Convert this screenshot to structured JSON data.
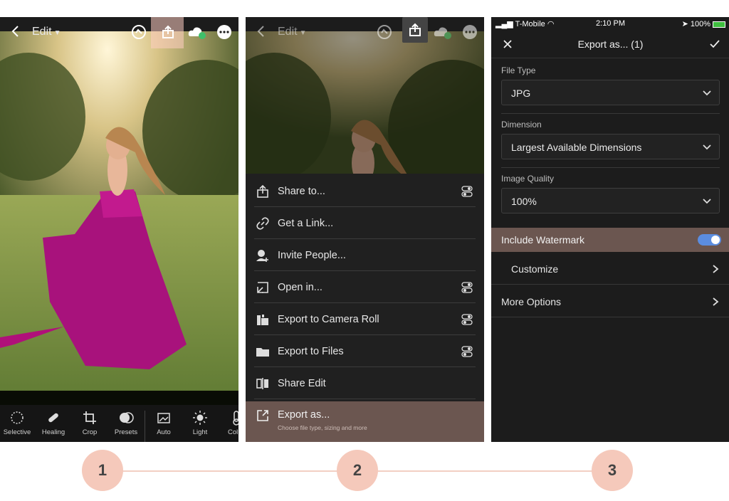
{
  "colors": {
    "accent_highlight": "#6b5650",
    "toggle_on": "#5b8de0",
    "panel_bg": "#1c1c1c",
    "step_circle": "#f5c9bb",
    "step_line": "#f2cfc3"
  },
  "panel1": {
    "header": {
      "edit_label": "Edit"
    },
    "toolbar": [
      {
        "label": "Selective",
        "icon": "selective-icon"
      },
      {
        "label": "Healing",
        "icon": "healing-icon"
      },
      {
        "label": "Crop",
        "icon": "crop-icon"
      },
      {
        "label": "Presets",
        "icon": "presets-icon"
      },
      {
        "label": "Auto",
        "icon": "auto-icon"
      },
      {
        "label": "Light",
        "icon": "light-icon"
      },
      {
        "label": "Col",
        "icon": "color-icon"
      }
    ]
  },
  "panel2": {
    "header": {
      "edit_label": "Edit"
    },
    "menu": [
      {
        "label": "Share to...",
        "icon": "share-icon",
        "has_toggle": true
      },
      {
        "label": "Get a Link...",
        "icon": "link-icon",
        "has_toggle": false
      },
      {
        "label": "Invite People...",
        "icon": "invite-people-icon",
        "has_toggle": false
      },
      {
        "label": "Open in...",
        "icon": "open-in-icon",
        "has_toggle": true
      },
      {
        "label": "Export to Camera Roll",
        "icon": "camera-roll-icon",
        "has_toggle": true
      },
      {
        "label": "Export to Files",
        "icon": "folder-icon",
        "has_toggle": true
      },
      {
        "label": "Share Edit",
        "icon": "share-edit-icon",
        "has_toggle": false
      }
    ],
    "export_as": {
      "label": "Export as...",
      "subtitle": "Choose file type, sizing and more"
    }
  },
  "panel3": {
    "status": {
      "carrier": "T-Mobile",
      "time": "2:10 PM",
      "battery": "100%"
    },
    "title": "Export as... (1)",
    "file_type": {
      "label": "File Type",
      "value": "JPG"
    },
    "dimension": {
      "label": "Dimension",
      "value": "Largest Available Dimensions"
    },
    "image_quality": {
      "label": "Image Quality",
      "value": "100%"
    },
    "watermark": {
      "label": "Include Watermark",
      "enabled": true
    },
    "customize": {
      "label": "Customize"
    },
    "more_options": {
      "label": "More Options"
    }
  },
  "steps": [
    "1",
    "2",
    "3"
  ]
}
